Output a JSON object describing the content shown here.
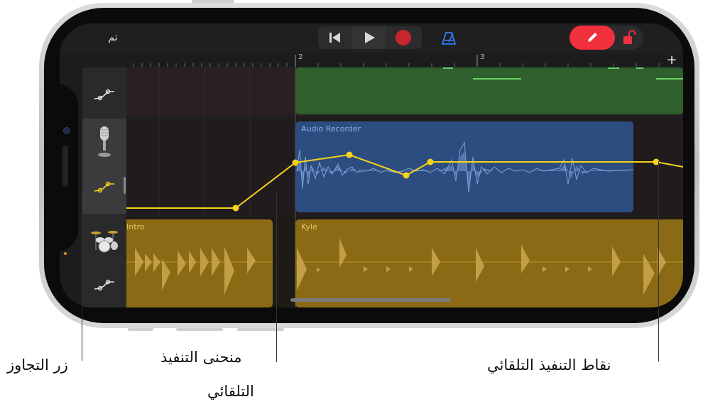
{
  "toolbar": {
    "done_label": "تم",
    "rewind_icon": "skip-back-icon",
    "play_icon": "play-icon",
    "record_icon": "record-icon",
    "metronome_icon": "metronome-icon",
    "pencil_icon": "pencil-icon",
    "lock_icon": "unlocked-icon",
    "accent_red": "#f0303a",
    "metronome_color": "#2f7cf6"
  },
  "ruler": {
    "bar_labels": [
      "2",
      "3"
    ],
    "add_label": "+"
  },
  "tracks": {
    "header_icons": [
      "automation-icon",
      "microphone-icon",
      "automation-icon",
      "drum-kit-icon",
      "automation-icon"
    ],
    "regions": {
      "audio_recorder": "Audio Recorder",
      "intro": "Intro",
      "kyle": "Kyle"
    },
    "colors": {
      "green": "#2f5f2c",
      "blue": "#2c4d7f",
      "gold": "#8a6a14",
      "automation": "#f5d21b"
    }
  },
  "callouts": {
    "bypass_button": "زر التجاوز",
    "automation_curve_line1": "منحنى التنفيذ",
    "automation_curve_line2": "التلقائي",
    "automation_points": "نقاط التنفيذ التلقائي"
  }
}
